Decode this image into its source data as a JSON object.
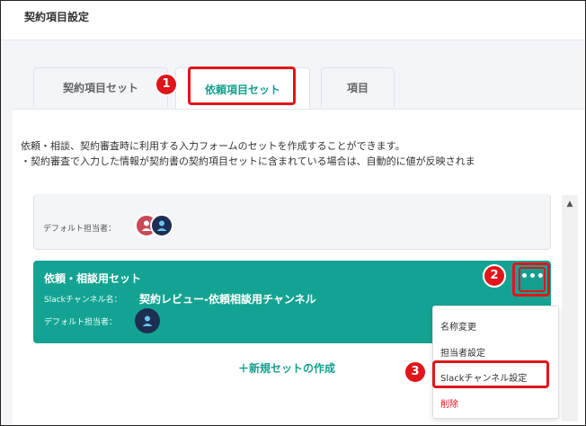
{
  "header": {
    "title": "契約項目設定"
  },
  "tabs": [
    {
      "label": "契約項目セット"
    },
    {
      "label": "依頼項目セット"
    },
    {
      "label": "項目"
    }
  ],
  "description": {
    "line1": "依頼・相談、契約審査時に利用する入力フォームのセットを作成することができます。",
    "line2": "・契約審査で入力した情報が契約書の契約項目セットに含まれている場合は、自動的に値が反映されま"
  },
  "sets": [
    {
      "assignee_label": "デフォルト担当者："
    },
    {
      "name": "依頼・相談用セット",
      "slack_label": "Slackチャンネル名：",
      "slack_value": "契約レビュー-依頼相談用チャンネル",
      "assignee_label": "デフォルト担当者："
    }
  ],
  "more_button": {
    "label": "•••"
  },
  "new_set": {
    "label": "＋新規セットの作成"
  },
  "menu": {
    "items": [
      {
        "label": "名称変更"
      },
      {
        "label": "担当者設定"
      },
      {
        "label": "Slackチャンネル設定"
      },
      {
        "label": "削除"
      }
    ]
  },
  "badges": [
    "1",
    "2",
    "3"
  ],
  "colors": {
    "accent": "#159e8e",
    "highlight": "#e0161a",
    "avatar": "#1c2f52"
  },
  "icons": {
    "avatar": "person-icon",
    "scroll": "arrow-up-icon"
  }
}
